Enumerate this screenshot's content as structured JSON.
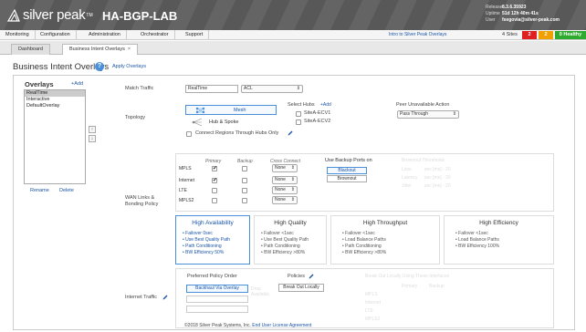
{
  "header": {
    "logo_text": "silver peak",
    "logo_tm": "TM",
    "hostname": "HA-BGP-LAB",
    "release_label": "Release",
    "release_value": "8.3.6.35923",
    "uptime_label": "Uptime",
    "uptime_value": "51d 12h 40m 41s",
    "user_label": "User",
    "user_value": "fsegovia@silver-peak.com"
  },
  "menu": {
    "items": [
      "Monitoring",
      "Configuration",
      "Administration",
      "Orchestrator",
      "Support"
    ],
    "intro_link": "Intro to Silver Peak Overlays",
    "sites": "4 Sites",
    "badge_red": "2",
    "badge_orange": "2",
    "badge_green": "0 Healthy",
    "colors": {
      "red": "#e02020",
      "orange": "#f0a000",
      "green": "#2eaa2e"
    }
  },
  "tabs": [
    {
      "label": "Dashboard"
    },
    {
      "label": "Business Intent Overlays",
      "close": "×"
    }
  ],
  "page": {
    "title": "Business Intent Overlays",
    "help_icon": "?",
    "apply_link": "Apply Overlays"
  },
  "overlays": {
    "title": "Overlays",
    "add": "+Add",
    "items": [
      "RealTime",
      "Interactive",
      "DefaultOverlay"
    ],
    "selected_index": 0,
    "up_arrow": "↑",
    "down_arrow": "↓",
    "rename": "Rename",
    "delete": "Delete"
  },
  "match": {
    "label": "Match Traffic",
    "value": "RealTime",
    "acl": "ACL"
  },
  "topology": {
    "label": "Topology",
    "mesh": "Mesh",
    "hub_spoke": "Hub & Spoke",
    "connect_hubs": "Connect Regions Through Hubs Only",
    "select_hubs": "Select Hubs",
    "add": "+Add",
    "hubs": [
      "SiteA-ECV1",
      "SiteA-ECV2"
    ],
    "peer_label": "Peer Unavailable Action",
    "peer_value": "Pass Through"
  },
  "wan": {
    "label_line1": "WAN Links &",
    "label_line2": "Bonding Policy",
    "col_primary": "Primary",
    "col_backup": "Backup",
    "col_cross": "Cross Connect",
    "links": [
      {
        "name": "MPLS",
        "primary": true,
        "cross": "None"
      },
      {
        "name": "Internet",
        "primary": true,
        "cross": "None"
      },
      {
        "name": "LTE",
        "primary": false,
        "cross": "None"
      },
      {
        "name": "MPLS2",
        "primary": false,
        "cross": "None"
      }
    ],
    "backup_ports_label": "Use Backup Ports on",
    "blackout": "Blackout",
    "brownout": "Brownout",
    "ghost_title": "Brownout Thresholds",
    "ghost_rows": [
      "Loss",
      "Latency",
      "Jitter"
    ],
    "ghost_values": [
      "sec [ms] - 20",
      "sec [ms] - 30",
      "sec [ms] - 20"
    ]
  },
  "policies": [
    {
      "title": "High Availability",
      "bullets": [
        "Failover 0sec",
        "Use Best Quality Path",
        "Path Conditioning",
        "BW Efficiency 50%"
      ]
    },
    {
      "title": "High Quality",
      "bullets": [
        "Failover <1sec",
        "Use Best Quality Path",
        "Path Conditioning",
        "BW Efficiency >80%"
      ]
    },
    {
      "title": "High Throughput",
      "bullets": [
        "Failover <1sec",
        "Load Balance Paths",
        "Path Conditioning",
        "BW Efficiency >80%"
      ]
    },
    {
      "title": "High Efficiency",
      "bullets": [
        "Failover <1sec",
        "Load Balance Paths",
        "BW Efficiency 100%"
      ]
    }
  ],
  "internet": {
    "label": "Internet Traffic",
    "preferred_label": "Preferred Policy Order",
    "backhaul": "Backhaul Via Overlay",
    "ghost_mid": "Drop Available",
    "policies_label": "Policies",
    "break_out": "Break Out Locally",
    "ghost_title": "Break Out Locally Using These Interfaces",
    "ghost_cols": [
      "Primary",
      "Backup"
    ],
    "ghost_rows": [
      "MPLS",
      "Internet",
      "LTE",
      "MPLS2"
    ]
  },
  "footer": {
    "copyright": "©2018 Silver Peak Systems, Inc.",
    "license": "End User License Agreement"
  }
}
